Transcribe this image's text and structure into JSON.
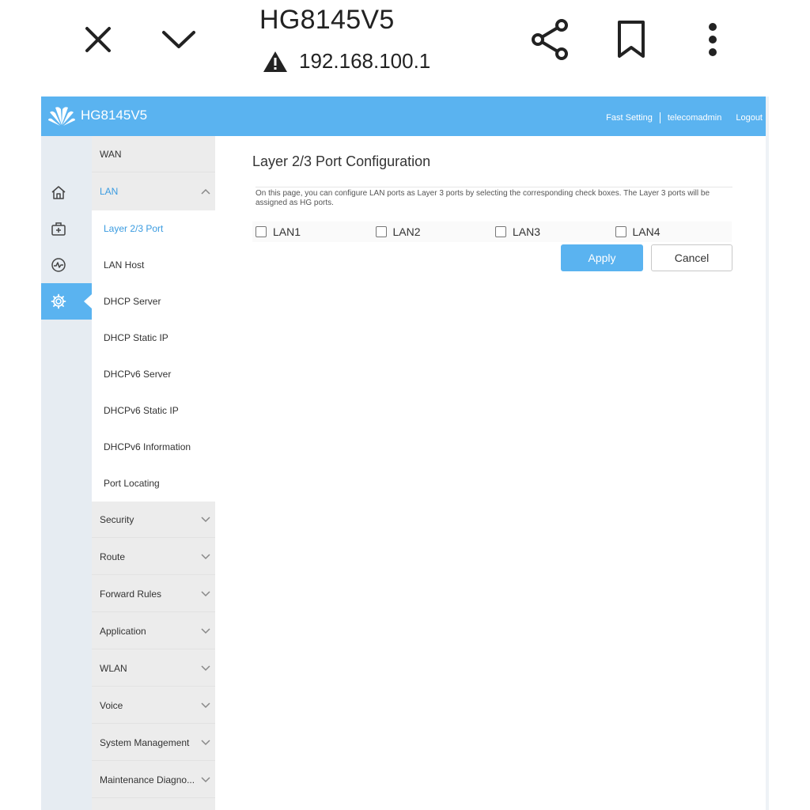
{
  "browser": {
    "title": "HG8145V5",
    "url": "192.168.100.1",
    "icons": [
      "close-icon",
      "chevron-down-icon",
      "share-icon",
      "bookmark-icon",
      "more-vert-icon",
      "warning-icon"
    ]
  },
  "header": {
    "brand": "HG8145V5",
    "fast_setting": "Fast Setting",
    "user": "telecomadmin",
    "logout": "Logout",
    "accent": "#5ab3f0"
  },
  "rail": {
    "icons": [
      "home-icon",
      "toolbox-icon",
      "diagnosis-icon",
      "gear-icon"
    ]
  },
  "menu": {
    "wan": "WAN",
    "lan": "LAN",
    "lan_items": [
      "Layer 2/3 Port",
      "LAN Host",
      "DHCP Server",
      "DHCP Static IP",
      "DHCPv6 Server",
      "DHCPv6 Static IP",
      "DHCPv6 Information",
      "Port Locating"
    ],
    "groups": [
      "Security",
      "Route",
      "Forward Rules",
      "Application",
      "WLAN",
      "Voice",
      "System Management",
      "Maintenance Diagno..."
    ]
  },
  "content": {
    "title": "Layer 2/3 Port Configuration",
    "description": "On this page, you can configure LAN ports as Layer 3 ports by selecting the corresponding check boxes. The Layer 3 ports will be assigned as HG ports.",
    "ports": [
      "LAN1",
      "LAN2",
      "LAN3",
      "LAN4"
    ],
    "apply": "Apply",
    "cancel": "Cancel"
  }
}
